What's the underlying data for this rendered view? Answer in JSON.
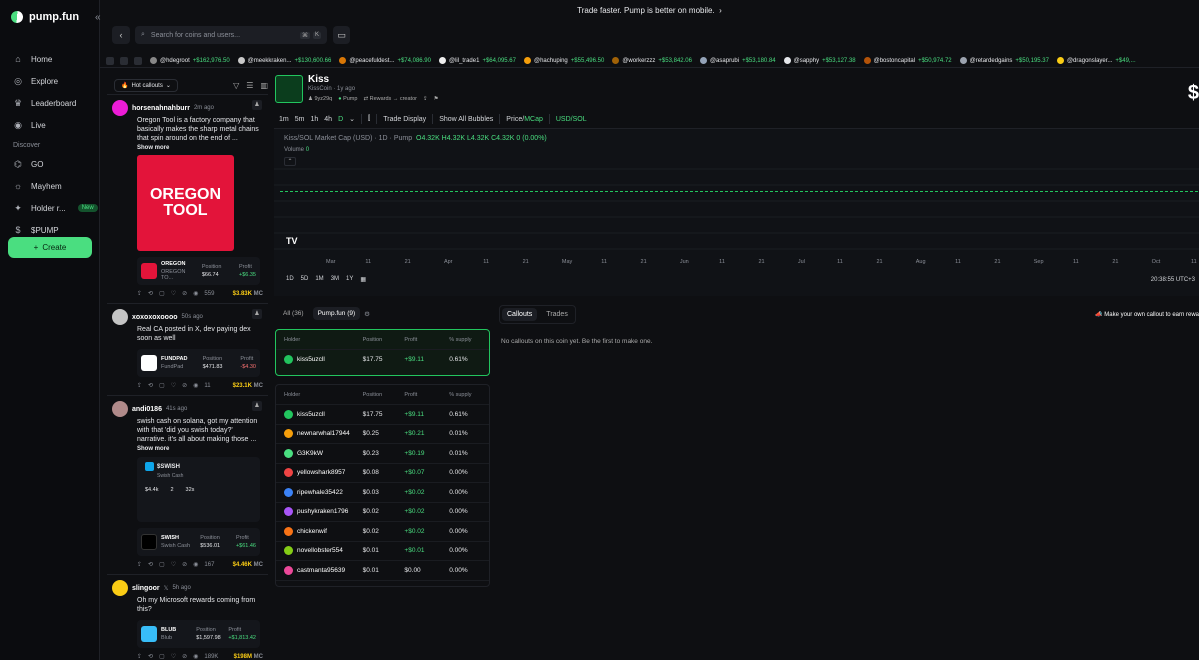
{
  "brand": "pump.fun",
  "nav": {
    "items": [
      {
        "label": "Home",
        "icon": "home-icon"
      },
      {
        "label": "Explore",
        "icon": "compass-icon"
      },
      {
        "label": "Leaderboard",
        "icon": "trophy-icon"
      },
      {
        "label": "Live",
        "icon": "live-icon"
      }
    ],
    "discover_label": "Discover",
    "discover": [
      {
        "label": "GO"
      },
      {
        "label": "Mayhem"
      },
      {
        "label": "Holder r...",
        "badge": "New"
      },
      {
        "label": "$PUMP"
      }
    ],
    "create_label": "Create"
  },
  "banner": "Trade faster. Pump is better on mobile.",
  "search": {
    "placeholder": "Search for coins and users...",
    "k1": "⌘",
    "k2": "K"
  },
  "ticker": [
    {
      "name": "@hdegroot",
      "value": "+$162,976.50"
    },
    {
      "name": "@meekkraken...",
      "value": "+$130,600.66"
    },
    {
      "name": "@peacefuldest...",
      "value": "+$74,086.90"
    },
    {
      "name": "@lil_trade1",
      "value": "+$64,095.67"
    },
    {
      "name": "@hachuping",
      "value": "+$55,496.50"
    },
    {
      "name": "@workerzzz",
      "value": "+$53,842.06"
    },
    {
      "name": "@asaprubi",
      "value": "+$53,180.84"
    },
    {
      "name": "@sapphy",
      "value": "+$53,127.38"
    },
    {
      "name": "@bostoncapital",
      "value": "+$50,974.72"
    },
    {
      "name": "@retardedgains",
      "value": "+$50,195.37"
    },
    {
      "name": "@dragonslayer...",
      "value": "+$49,..."
    }
  ],
  "feed": {
    "filter": "Hot callouts",
    "posts": [
      {
        "user": "horsenahnahburr",
        "time": "2m ago",
        "text": "Oregon Tool is a factory company that basically makes the sharp metal chains that spin around on the end of ...",
        "more": "Show more",
        "image_text": "OREGON TOOL",
        "coin": {
          "ticker": "OREGON",
          "name": "OREGON TO...",
          "position": "$66.74",
          "profit": "+$6.35"
        },
        "views": "559",
        "mc": "$3.83K"
      },
      {
        "user": "xoxoxoxoooo",
        "time": "50s ago",
        "text": "Real CA posted in X, dev paying dex soon as well",
        "coin": {
          "ticker": "FUNDPAD",
          "name": "FundPad",
          "position": "$471.83",
          "profit": "-$4.30"
        },
        "views": "11",
        "mc": "$23.1K"
      },
      {
        "user": "andi0186",
        "time": "41s ago",
        "text": "swish cash on solana, got my attention with that 'did you swish today?' narrative. it's all about making those ...",
        "more": "Show more",
        "card": {
          "ticker": "$SWISH",
          "sub": "Swish Cash",
          "v1": "$4.4k",
          "v2": "2",
          "v3": "32s"
        },
        "coin": {
          "ticker": "SWISH",
          "name": "Swish Cash",
          "position": "$536.01",
          "profit": "+$61.46"
        },
        "views": "167",
        "mc": "$4.46K"
      },
      {
        "user": "slingoor",
        "time": "5h ago",
        "text": "Oh my Microsoft rewards coming from this?",
        "coin": {
          "ticker": "BLUB",
          "name": "Blub",
          "position": "$1,597.98",
          "profit": "+$1,813.42"
        },
        "views": "189K",
        "mc": "$198M"
      }
    ],
    "position_label": "Position",
    "profit_label": "Profit",
    "mc_label": "MC"
  },
  "coin": {
    "name": "Kiss",
    "symbol": "KissCoin",
    "age": "1y ago",
    "creator": "9yz29q",
    "platform": "Pump",
    "rewards": "Rewards → creator",
    "price_partial": "$"
  },
  "chart_toolbar": {
    "intervals": [
      "1m",
      "5m",
      "1h",
      "4h",
      "D"
    ],
    "selected_interval": "D",
    "trade_display": "Trade Display",
    "bubbles": "Show All Bubbles",
    "price_mcap": "Price/",
    "mcap": "MCap",
    "usd_sol": "USD/SOL"
  },
  "chart_data": {
    "type": "line",
    "title": "Kiss/SOL Market Cap (USD) · 1D · Pump",
    "ohlc": "O4.32K H4.32K L4.32K C4.32K 0 (0.00%)",
    "volume_label": "Volume",
    "volume_value": "0",
    "x_ticks": [
      "Mar",
      "11",
      "21",
      "Apr",
      "11",
      "21",
      "May",
      "11",
      "21",
      "Jun",
      "11",
      "21",
      "Jul",
      "11",
      "21",
      "Aug",
      "11",
      "21",
      "Sep",
      "11",
      "21",
      "Oct",
      "11"
    ],
    "series": [
      {
        "values": [
          4.32,
          4.32
        ]
      }
    ],
    "ranges": [
      "1D",
      "5D",
      "1M",
      "3M",
      "1Y"
    ],
    "clock": "20:38:55 UTC+3",
    "line_color": "#22c55e"
  },
  "holders": {
    "tabs": [
      {
        "label": "All (36)"
      },
      {
        "label": "Pump.fun (9)"
      }
    ],
    "columns": [
      "Holder",
      "Position",
      "Profit",
      "% supply"
    ],
    "top": {
      "name": "kiss5uzcll",
      "position": "$17.75",
      "profit": "+$9.11",
      "supply": "0.61%"
    },
    "rows": [
      {
        "name": "kiss5uzcll",
        "position": "$17.75",
        "profit": "+$9.11",
        "supply": "0.61%",
        "color": "#22c55e"
      },
      {
        "name": "newnarwhal17944",
        "position": "$0.25",
        "profit": "+$0.21",
        "supply": "0.01%",
        "color": "#f59e0b"
      },
      {
        "name": "G3K9kW",
        "position": "$0.23",
        "profit": "+$0.19",
        "supply": "0.01%",
        "color": "#4ade80"
      },
      {
        "name": "yellowshark8957",
        "position": "$0.08",
        "profit": "+$0.07",
        "supply": "0.00%",
        "color": "#ef4444"
      },
      {
        "name": "ripewhale35422",
        "position": "$0.03",
        "profit": "+$0.02",
        "supply": "0.00%",
        "color": "#3b82f6"
      },
      {
        "name": "pushykraken1796",
        "position": "$0.02",
        "profit": "+$0.02",
        "supply": "0.00%",
        "color": "#a855f7"
      },
      {
        "name": "chickenwif",
        "position": "$0.02",
        "profit": "+$0.02",
        "supply": "0.00%",
        "color": "#f97316"
      },
      {
        "name": "novellobster554",
        "position": "$0.01",
        "profit": "+$0.01",
        "supply": "0.00%",
        "color": "#84cc16"
      },
      {
        "name": "castmanta95639",
        "position": "$0.01",
        "profit": "$0.00",
        "supply": "0.00%",
        "color": "#ec4899"
      }
    ]
  },
  "callouts": {
    "tabs": [
      "Callouts",
      "Trades"
    ],
    "empty": "No callouts on this coin yet. Be the first to make one.",
    "cta": "Make your own callout to earn rewa"
  }
}
